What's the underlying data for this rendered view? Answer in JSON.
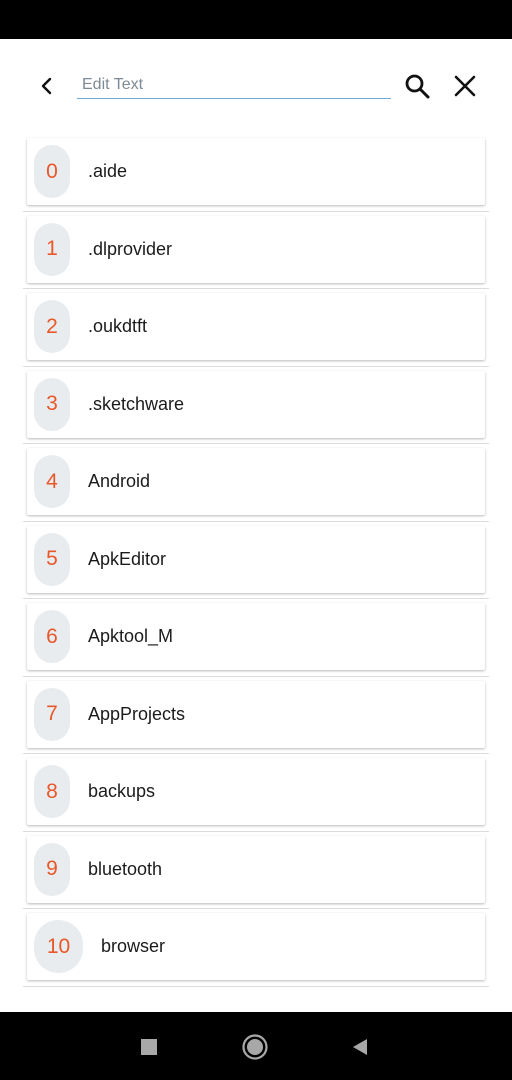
{
  "search": {
    "placeholder": "Edit Text",
    "value": ""
  },
  "icons": {
    "back": "back-arrow-icon",
    "search": "search-icon",
    "close": "close-icon",
    "nav_recents": "square-icon",
    "nav_home": "circle-icon",
    "nav_back": "triangle-back-icon"
  },
  "colors": {
    "badge_number": "#e8582a",
    "badge_bg": "#e8ecef",
    "input_underline": "#6aa9d8"
  },
  "folders": [
    {
      "index": "0",
      "name": ".aide"
    },
    {
      "index": "1",
      "name": ".dlprovider"
    },
    {
      "index": "2",
      "name": ".oukdtft"
    },
    {
      "index": "3",
      "name": ".sketchware"
    },
    {
      "index": "4",
      "name": "Android"
    },
    {
      "index": "5",
      "name": "ApkEditor"
    },
    {
      "index": "6",
      "name": "Apktool_M"
    },
    {
      "index": "7",
      "name": "AppProjects"
    },
    {
      "index": "8",
      "name": "backups"
    },
    {
      "index": "9",
      "name": "bluetooth"
    },
    {
      "index": "10",
      "name": "browser"
    }
  ]
}
